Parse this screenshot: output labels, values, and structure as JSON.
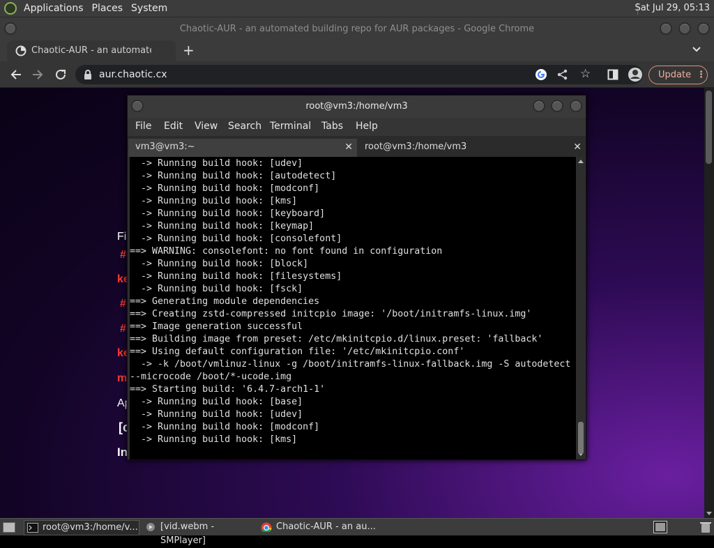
{
  "top_panel": {
    "menus": [
      "Applications",
      "Places",
      "System"
    ],
    "clock": "Sat Jul 29, 05:13"
  },
  "chrome": {
    "window_title": "Chaotic-AUR - an automated building repo for AUR packages - Google Chrome",
    "tab_title": "Chaotic-AUR - an automated b",
    "url": "aur.chaotic.cx",
    "update_label": "Update"
  },
  "page": {
    "fragments": [
      "Fi",
      "#",
      "ke",
      "#",
      "#",
      "ke",
      "m",
      "Ap",
      "[c",
      "In"
    ]
  },
  "terminal": {
    "title": "root@vm3:/home/vm3",
    "menu": [
      "File",
      "Edit",
      "View",
      "Search",
      "Terminal",
      "Tabs",
      "Help"
    ],
    "tabs": [
      "vm3@vm3:~",
      "root@vm3:/home/vm3"
    ],
    "lines": [
      "  -> Running build hook: [udev]",
      "  -> Running build hook: [autodetect]",
      "  -> Running build hook: [modconf]",
      "  -> Running build hook: [kms]",
      "  -> Running build hook: [keyboard]",
      "  -> Running build hook: [keymap]",
      "  -> Running build hook: [consolefont]",
      "==> WARNING: consolefont: no font found in configuration",
      "  -> Running build hook: [block]",
      "  -> Running build hook: [filesystems]",
      "  -> Running build hook: [fsck]",
      "==> Generating module dependencies",
      "==> Creating zstd-compressed initcpio image: '/boot/initramfs-linux.img'",
      "==> Image generation successful",
      "==> Building image from preset: /etc/mkinitcpio.d/linux.preset: 'fallback'",
      "==> Using default configuration file: '/etc/mkinitcpio.conf'",
      "  -> -k /boot/vmlinuz-linux -g /boot/initramfs-linux-fallback.img -S autodetect",
      "--microcode /boot/*-ucode.img",
      "==> Starting build: '6.4.7-arch1-1'",
      "  -> Running build hook: [base]",
      "  -> Running build hook: [udev]",
      "  -> Running build hook: [modconf]",
      "  -> Running build hook: [kms]"
    ]
  },
  "taskbar": {
    "items": [
      "root@vm3:/home/v...",
      "[vid.webm - SMPlayer]",
      "Chaotic-AUR - an au..."
    ]
  },
  "colors": {
    "page_accent": "#ff3b30",
    "panel_bg": "#3c3c3c",
    "terminal_bg": "#000000"
  }
}
